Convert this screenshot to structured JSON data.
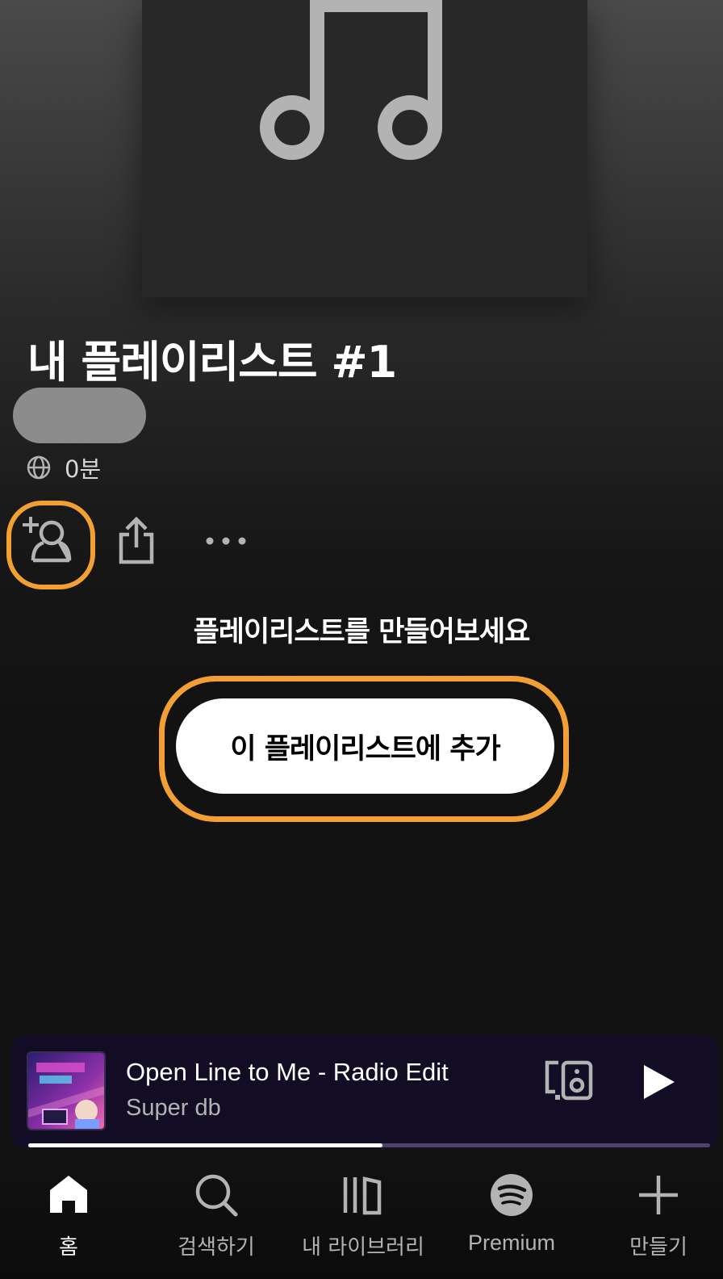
{
  "playlist": {
    "title": "내 플레이리스트 #1",
    "duration": "0분"
  },
  "empty_state": {
    "heading": "플레이리스트를 만들어보세요",
    "add_button_label": "이 플레이리스트에 추가"
  },
  "now_playing": {
    "track_title": "Open Line to Me - Radio Edit",
    "artist": "Super db",
    "progress_percent": 52
  },
  "bottom_nav": {
    "items": [
      {
        "label": "홈",
        "icon": "home-icon",
        "active": true
      },
      {
        "label": "검색하기",
        "icon": "search-icon",
        "active": false
      },
      {
        "label": "내 라이브러리",
        "icon": "library-icon",
        "active": false
      },
      {
        "label": "Premium",
        "icon": "spotify-icon",
        "active": false
      },
      {
        "label": "만들기",
        "icon": "plus-icon",
        "active": false
      }
    ]
  },
  "colors": {
    "highlight": "#f2a033",
    "background": "#121212",
    "mini_player": "#120c24",
    "icon_gray": "#b3b3b3"
  }
}
